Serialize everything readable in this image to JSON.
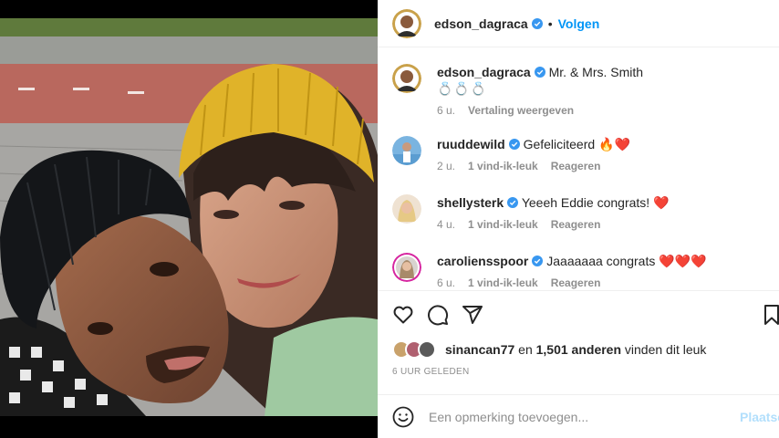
{
  "post": {
    "author": "edson_dagraca",
    "follow_label": "Volgen",
    "separator": "•"
  },
  "comments": [
    {
      "username": "edson_dagraca",
      "text": "Mr. & Mrs. Smith",
      "extra": "💍💍💍",
      "time": "6 u.",
      "meta2": "Vertaling weergeven",
      "meta3": ""
    },
    {
      "username": "ruuddewild",
      "text": "Gefeliciteerd 🔥❤️",
      "time": "2 u.",
      "meta2": "1 vind-ik-leuk",
      "meta3": "Reageren"
    },
    {
      "username": "shellysterk",
      "text": "Yeeeh Eddie congrats! ❤️",
      "time": "4 u.",
      "meta2": "1 vind-ik-leuk",
      "meta3": "Reageren"
    },
    {
      "username": "caroliensspoor",
      "text": "Jaaaaaaa congrats ❤️❤️❤️",
      "time": "6 u.",
      "meta2": "1 vind-ik-leuk",
      "meta3": "Reageren"
    }
  ],
  "likes": {
    "first_liker": "sinancan77",
    "connector": "en",
    "others_count": "1,501 anderen",
    "suffix": "vinden dit leuk"
  },
  "timestamp": "6 UUR GELEDEN",
  "comment_box": {
    "placeholder": "Een opmerking toevoegen...",
    "post_label": "Plaatsen"
  },
  "icons": [
    "heart-icon",
    "comment-icon",
    "share-icon",
    "bookmark-icon",
    "emoji-icon",
    "verified-badge-icon"
  ],
  "colors": {
    "link": "#0095f6",
    "muted": "#8e8e8e",
    "verified": "#3897f0",
    "post_disabled": "#b2dffc"
  }
}
